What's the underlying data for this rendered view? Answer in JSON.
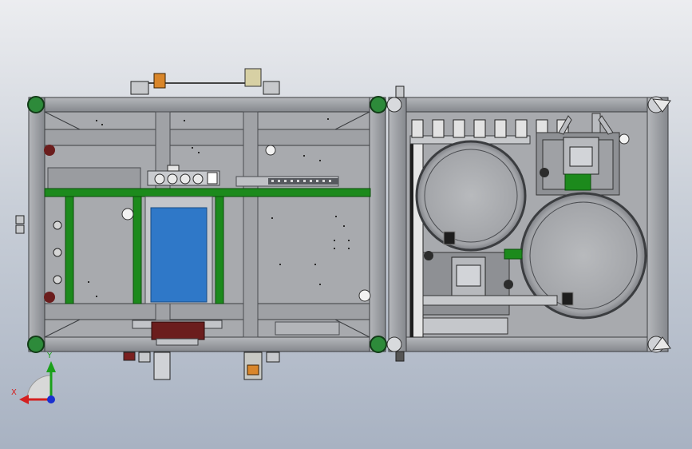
{
  "scene": {
    "background_top": "#ecedf0",
    "background_bottom": "#a8b2c2",
    "colors": {
      "frame": "#8e9196",
      "plate": "#a7a9ad",
      "green_rail": "#1c8a1c",
      "blue_panel": "#2f78c8",
      "green_corner": "#2d8a3a",
      "dark_red": "#6b1d1d",
      "orange": "#d9862a"
    }
  },
  "triad": {
    "x_label": "X",
    "y_label": "Y",
    "x_color": "#d42020",
    "y_color": "#1aa01a",
    "z_color": "#1a30d0"
  }
}
